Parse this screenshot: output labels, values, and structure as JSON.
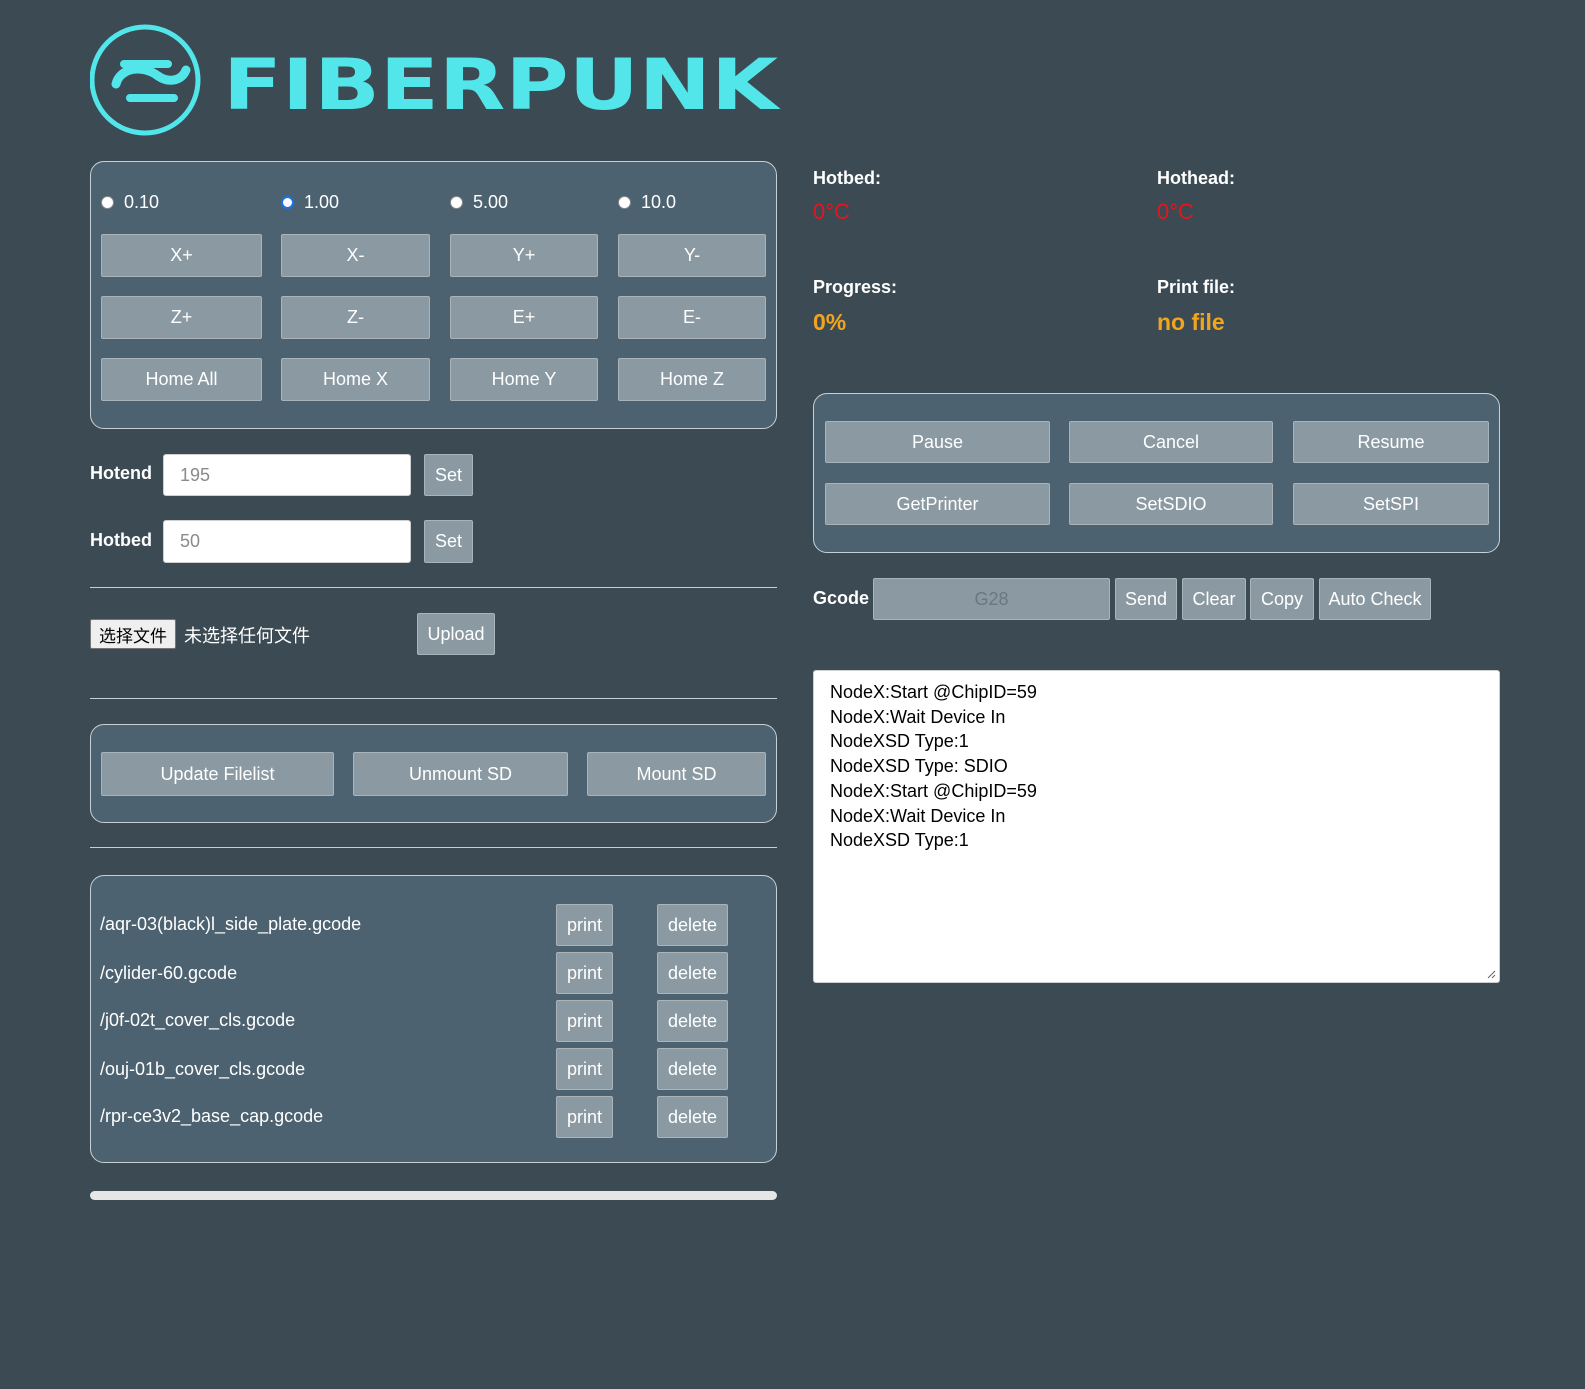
{
  "brand": {
    "name": "FIBERPUNK",
    "color": "#52e6ea"
  },
  "move": {
    "steps": [
      "0.10",
      "1.00",
      "5.00",
      "10.0"
    ],
    "selected_step": "1.00",
    "axis_buttons": [
      "X+",
      "X-",
      "Y+",
      "Y-",
      "Z+",
      "Z-",
      "E+",
      "E-"
    ],
    "home_buttons": [
      "Home All",
      "Home X",
      "Home Y",
      "Home Z"
    ]
  },
  "temps": {
    "hotend_label": "Hotend",
    "hotend_placeholder": "195",
    "hotbed_label": "Hotbed",
    "hotbed_placeholder": "50",
    "set_label": "Set"
  },
  "upload": {
    "choose_label": "选择文件",
    "no_file_text": "未选择任何文件",
    "upload_label": "Upload"
  },
  "sd": {
    "update_label": "Update Filelist",
    "unmount_label": "Unmount SD",
    "mount_label": "Mount SD"
  },
  "files": {
    "print_label": "print",
    "delete_label": "delete",
    "items": [
      "/aqr-03(black)l_side_plate.gcode",
      "/cylider-60.gcode",
      "/j0f-02t_cover_cls.gcode",
      "/ouj-01b_cover_cls.gcode",
      "/rpr-ce3v2_base_cap.gcode"
    ]
  },
  "status": {
    "hotbed_label": "Hotbed:",
    "hotbed_value": "0°C",
    "hothead_label": "Hothead:",
    "hothead_value": "0°C",
    "progress_label": "Progress:",
    "progress_value": "0%",
    "printfile_label": "Print file:",
    "printfile_value": "no file",
    "upload_progress_fraction": 0
  },
  "control": {
    "pause": "Pause",
    "cancel": "Cancel",
    "resume": "Resume",
    "getprinter": "GetPrinter",
    "setsdio": "SetSDIO",
    "setspi": "SetSPI"
  },
  "gcode": {
    "label": "Gcode",
    "placeholder": "G28",
    "send": "Send",
    "clear": "Clear",
    "copy": "Copy",
    "autocheck": "Auto Check"
  },
  "console": {
    "lines": [
      "NodeX:Start @ChipID=59",
      "NodeX:Wait Device In",
      "NodeXSD Type:1",
      "NodeXSD Type: SDIO",
      "NodeX:Start @ChipID=59",
      "NodeX:Wait Device In",
      "NodeXSD Type:1"
    ]
  },
  "colors": {
    "background": "#3b4a53",
    "panel": "#4d6270",
    "button": "#8b9aa2",
    "temp_value": "#e8141b",
    "progress_value": "#f1a51f"
  }
}
